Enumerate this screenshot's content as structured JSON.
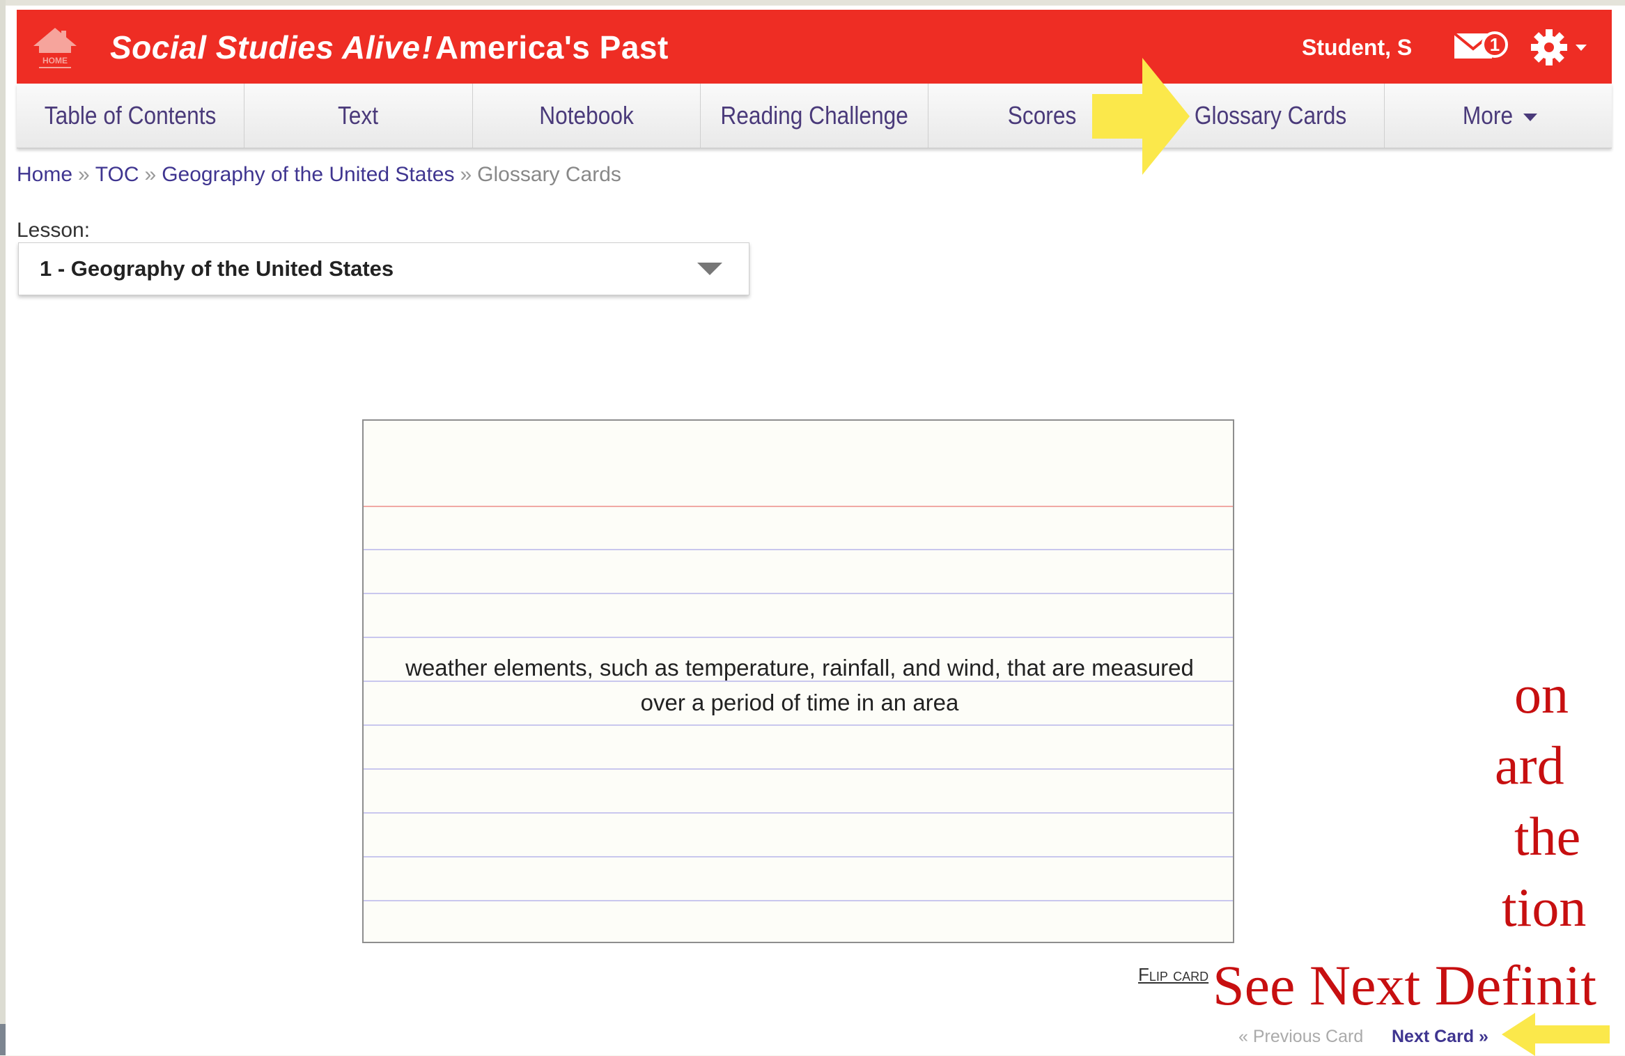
{
  "header": {
    "home_label": "HOME",
    "brand_part1": "Social Studies Alive",
    "brand_bang": "!",
    "brand_part2": "America's Past",
    "user_name": "Student, S",
    "mail_count": "1"
  },
  "nav": {
    "tabs": [
      {
        "label": "Table of Contents"
      },
      {
        "label": "Text"
      },
      {
        "label": "Notebook"
      },
      {
        "label": "Reading Challenge"
      },
      {
        "label": "Scores"
      },
      {
        "label": "Glossary Cards"
      },
      {
        "label": "More"
      }
    ]
  },
  "breadcrumb": {
    "home": "Home",
    "toc": "TOC",
    "chapter": "Geography of the United States",
    "current": "Glossary Cards",
    "sep": "»"
  },
  "lesson": {
    "label": "Lesson:",
    "selected": "1 - Geography of the United States"
  },
  "card": {
    "definition": "weather elements, such as temperature, rainfall, and wind, that are measured over a period of time in an area",
    "flip_label": "Flip card"
  },
  "pager": {
    "prev": "« Previous Card",
    "next": "Next Card »"
  },
  "overlay": {
    "line1": "on",
    "line2": "ard",
    "line3": "the",
    "line4": "tion",
    "line5": "See Next Definit"
  },
  "colors": {
    "brand_red": "#ee2d24",
    "link_purple": "#3f3590",
    "highlight_yellow": "#fbe84b",
    "overlay_red": "#c70f10"
  }
}
